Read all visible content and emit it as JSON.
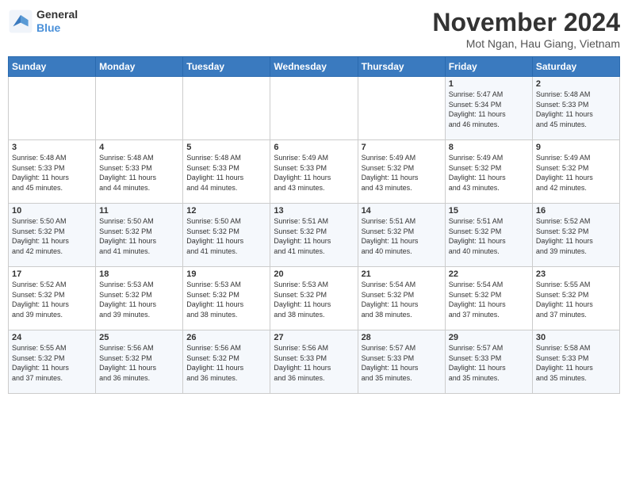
{
  "header": {
    "logo_line1": "General",
    "logo_line2": "Blue",
    "month_title": "November 2024",
    "subtitle": "Mot Ngan, Hau Giang, Vietnam"
  },
  "days_of_week": [
    "Sunday",
    "Monday",
    "Tuesday",
    "Wednesday",
    "Thursday",
    "Friday",
    "Saturday"
  ],
  "weeks": [
    [
      {
        "day": "",
        "info": ""
      },
      {
        "day": "",
        "info": ""
      },
      {
        "day": "",
        "info": ""
      },
      {
        "day": "",
        "info": ""
      },
      {
        "day": "",
        "info": ""
      },
      {
        "day": "1",
        "info": "Sunrise: 5:47 AM\nSunset: 5:34 PM\nDaylight: 11 hours\nand 46 minutes."
      },
      {
        "day": "2",
        "info": "Sunrise: 5:48 AM\nSunset: 5:33 PM\nDaylight: 11 hours\nand 45 minutes."
      }
    ],
    [
      {
        "day": "3",
        "info": "Sunrise: 5:48 AM\nSunset: 5:33 PM\nDaylight: 11 hours\nand 45 minutes."
      },
      {
        "day": "4",
        "info": "Sunrise: 5:48 AM\nSunset: 5:33 PM\nDaylight: 11 hours\nand 44 minutes."
      },
      {
        "day": "5",
        "info": "Sunrise: 5:48 AM\nSunset: 5:33 PM\nDaylight: 11 hours\nand 44 minutes."
      },
      {
        "day": "6",
        "info": "Sunrise: 5:49 AM\nSunset: 5:33 PM\nDaylight: 11 hours\nand 43 minutes."
      },
      {
        "day": "7",
        "info": "Sunrise: 5:49 AM\nSunset: 5:32 PM\nDaylight: 11 hours\nand 43 minutes."
      },
      {
        "day": "8",
        "info": "Sunrise: 5:49 AM\nSunset: 5:32 PM\nDaylight: 11 hours\nand 43 minutes."
      },
      {
        "day": "9",
        "info": "Sunrise: 5:49 AM\nSunset: 5:32 PM\nDaylight: 11 hours\nand 42 minutes."
      }
    ],
    [
      {
        "day": "10",
        "info": "Sunrise: 5:50 AM\nSunset: 5:32 PM\nDaylight: 11 hours\nand 42 minutes."
      },
      {
        "day": "11",
        "info": "Sunrise: 5:50 AM\nSunset: 5:32 PM\nDaylight: 11 hours\nand 41 minutes."
      },
      {
        "day": "12",
        "info": "Sunrise: 5:50 AM\nSunset: 5:32 PM\nDaylight: 11 hours\nand 41 minutes."
      },
      {
        "day": "13",
        "info": "Sunrise: 5:51 AM\nSunset: 5:32 PM\nDaylight: 11 hours\nand 41 minutes."
      },
      {
        "day": "14",
        "info": "Sunrise: 5:51 AM\nSunset: 5:32 PM\nDaylight: 11 hours\nand 40 minutes."
      },
      {
        "day": "15",
        "info": "Sunrise: 5:51 AM\nSunset: 5:32 PM\nDaylight: 11 hours\nand 40 minutes."
      },
      {
        "day": "16",
        "info": "Sunrise: 5:52 AM\nSunset: 5:32 PM\nDaylight: 11 hours\nand 39 minutes."
      }
    ],
    [
      {
        "day": "17",
        "info": "Sunrise: 5:52 AM\nSunset: 5:32 PM\nDaylight: 11 hours\nand 39 minutes."
      },
      {
        "day": "18",
        "info": "Sunrise: 5:53 AM\nSunset: 5:32 PM\nDaylight: 11 hours\nand 39 minutes."
      },
      {
        "day": "19",
        "info": "Sunrise: 5:53 AM\nSunset: 5:32 PM\nDaylight: 11 hours\nand 38 minutes."
      },
      {
        "day": "20",
        "info": "Sunrise: 5:53 AM\nSunset: 5:32 PM\nDaylight: 11 hours\nand 38 minutes."
      },
      {
        "day": "21",
        "info": "Sunrise: 5:54 AM\nSunset: 5:32 PM\nDaylight: 11 hours\nand 38 minutes."
      },
      {
        "day": "22",
        "info": "Sunrise: 5:54 AM\nSunset: 5:32 PM\nDaylight: 11 hours\nand 37 minutes."
      },
      {
        "day": "23",
        "info": "Sunrise: 5:55 AM\nSunset: 5:32 PM\nDaylight: 11 hours\nand 37 minutes."
      }
    ],
    [
      {
        "day": "24",
        "info": "Sunrise: 5:55 AM\nSunset: 5:32 PM\nDaylight: 11 hours\nand 37 minutes."
      },
      {
        "day": "25",
        "info": "Sunrise: 5:56 AM\nSunset: 5:32 PM\nDaylight: 11 hours\nand 36 minutes."
      },
      {
        "day": "26",
        "info": "Sunrise: 5:56 AM\nSunset: 5:32 PM\nDaylight: 11 hours\nand 36 minutes."
      },
      {
        "day": "27",
        "info": "Sunrise: 5:56 AM\nSunset: 5:33 PM\nDaylight: 11 hours\nand 36 minutes."
      },
      {
        "day": "28",
        "info": "Sunrise: 5:57 AM\nSunset: 5:33 PM\nDaylight: 11 hours\nand 35 minutes."
      },
      {
        "day": "29",
        "info": "Sunrise: 5:57 AM\nSunset: 5:33 PM\nDaylight: 11 hours\nand 35 minutes."
      },
      {
        "day": "30",
        "info": "Sunrise: 5:58 AM\nSunset: 5:33 PM\nDaylight: 11 hours\nand 35 minutes."
      }
    ]
  ]
}
